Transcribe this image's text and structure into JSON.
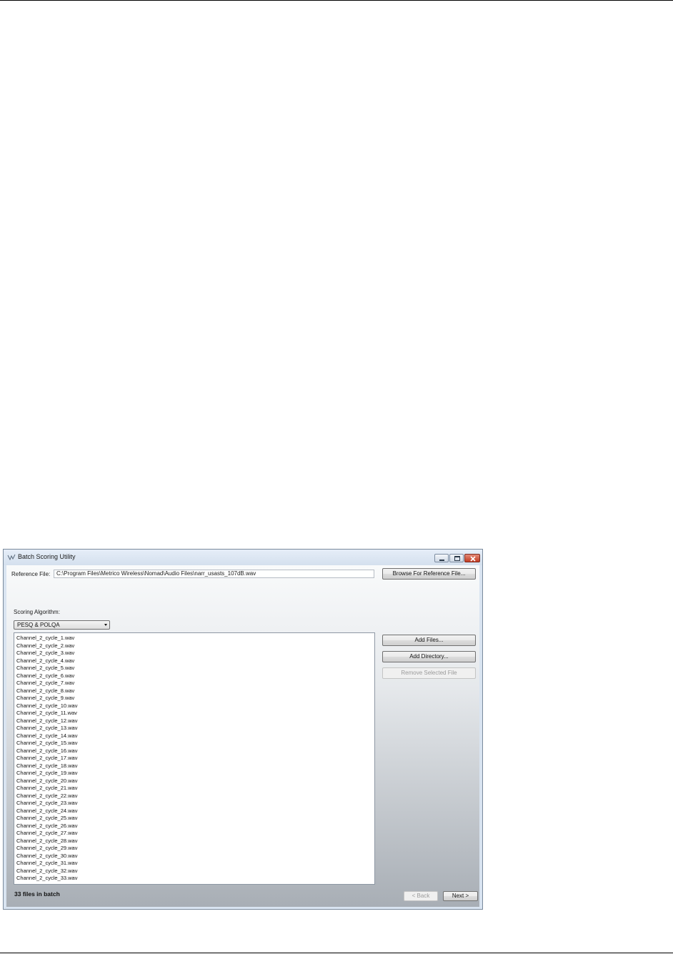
{
  "window": {
    "title": "Batch Scoring Utility",
    "title_icon": "audio-waveform-icon",
    "controls": [
      "minimize-icon",
      "maximize-icon",
      "close-icon"
    ]
  },
  "reference": {
    "label": "Reference File:",
    "value": "C:\\Program Files\\Metrico Wireless\\Nomad\\Audio Files\\narr_usasts_107dB.wav",
    "browse_label": "Browse For Reference File..."
  },
  "algorithm": {
    "label": "Scoring Algorithm:",
    "selected": "PESQ & POLQA"
  },
  "files": [
    "Channel_2_cycle_1.wav",
    "Channel_2_cycle_2.wav",
    "Channel_2_cycle_3.wav",
    "Channel_2_cycle_4.wav",
    "Channel_2_cycle_5.wav",
    "Channel_2_cycle_6.wav",
    "Channel_2_cycle_7.wav",
    "Channel_2_cycle_8.wav",
    "Channel_2_cycle_9.wav",
    "Channel_2_cycle_10.wav",
    "Channel_2_cycle_11.wav",
    "Channel_2_cycle_12.wav",
    "Channel_2_cycle_13.wav",
    "Channel_2_cycle_14.wav",
    "Channel_2_cycle_15.wav",
    "Channel_2_cycle_16.wav",
    "Channel_2_cycle_17.wav",
    "Channel_2_cycle_18.wav",
    "Channel_2_cycle_19.wav",
    "Channel_2_cycle_20.wav",
    "Channel_2_cycle_21.wav",
    "Channel_2_cycle_22.wav",
    "Channel_2_cycle_23.wav",
    "Channel_2_cycle_24.wav",
    "Channel_2_cycle_25.wav",
    "Channel_2_cycle_26.wav",
    "Channel_2_cycle_27.wav",
    "Channel_2_cycle_28.wav",
    "Channel_2_cycle_29.wav",
    "Channel_2_cycle_30.wav",
    "Channel_2_cycle_31.wav",
    "Channel_2_cycle_32.wav",
    "Channel_2_cycle_33.wav"
  ],
  "actions": {
    "add_files": "Add Files...",
    "add_directory": "Add Directory...",
    "remove_selected": "Remove Selected File"
  },
  "status": {
    "count_text": "33 files in batch"
  },
  "nav": {
    "back": "< Back",
    "next": "Next >"
  }
}
